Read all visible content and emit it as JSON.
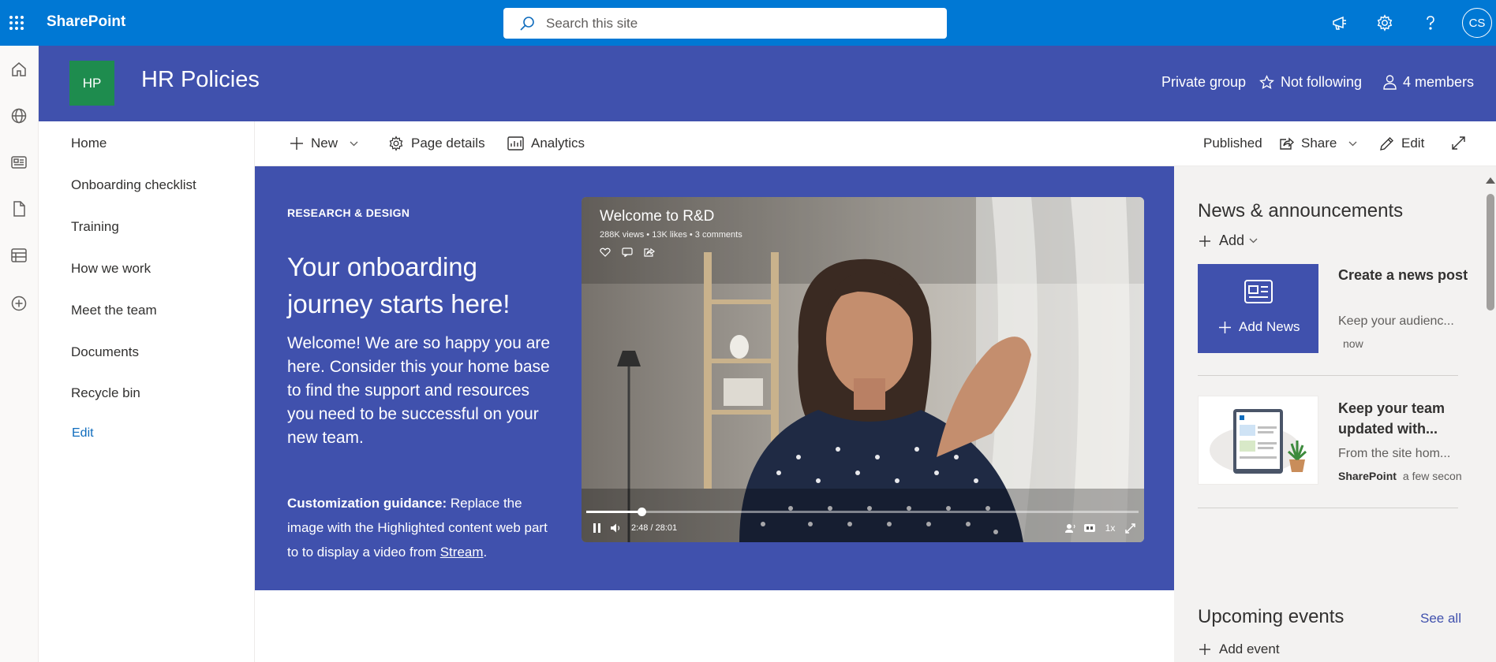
{
  "suite_bar": {
    "brand": "SharePoint",
    "search_placeholder": "Search this site",
    "avatar_initials": "CS",
    "color": "#0078d4"
  },
  "app_bar": {
    "icons": [
      "home-icon",
      "globe-icon",
      "news-feed-icon",
      "files-icon",
      "lists-icon",
      "create-icon"
    ]
  },
  "site_header": {
    "logo_initials": "HP",
    "logo_color": "#1e8c4e",
    "title": "HR Policies",
    "privacy": "Private group",
    "follow": "Not following",
    "members": "4 members",
    "color": "#4051ad"
  },
  "left_nav": {
    "items": [
      "Home",
      "Onboarding checklist",
      "Training",
      "How we work",
      "Meet the team",
      "Documents",
      "Recycle bin"
    ],
    "edit_label": "Edit"
  },
  "command_bar": {
    "new_label": "New",
    "page_details_label": "Page details",
    "analytics_label": "Analytics",
    "status": "Published",
    "share_label": "Share",
    "edit_label": "Edit"
  },
  "hero": {
    "topic": "RESEARCH & DESIGN",
    "title": "Your onboarding journey starts here!",
    "body": "Welcome! We are so happy you are here. Consider this your home base to find the support and resources you need to be successful on your new team.",
    "guidance_label": "Customization guidance:",
    "guidance_text": "Replace the image with the Highlighted content web part to to display a video from",
    "guidance_link": "Stream",
    "guidance_end": "."
  },
  "video": {
    "title": "Welcome to R&D",
    "stats": "288K views • 13K likes • 3 comments",
    "time": "2:48 / 28:01",
    "progress": 0.1,
    "speed": "1x"
  },
  "news": {
    "title": "News & announcements",
    "add_label": "Add",
    "add_news_label": "Add News",
    "items": [
      {
        "headline": "Create a news post",
        "desc": "Keep your audienc...",
        "author": "",
        "time": "now"
      },
      {
        "headline": "Keep your team updated with...",
        "desc": "From the site hom...",
        "author": "SharePoint",
        "time": "a few secon"
      }
    ]
  },
  "events": {
    "title": "Upcoming events",
    "see_all": "See all",
    "add_label": "Add event"
  }
}
